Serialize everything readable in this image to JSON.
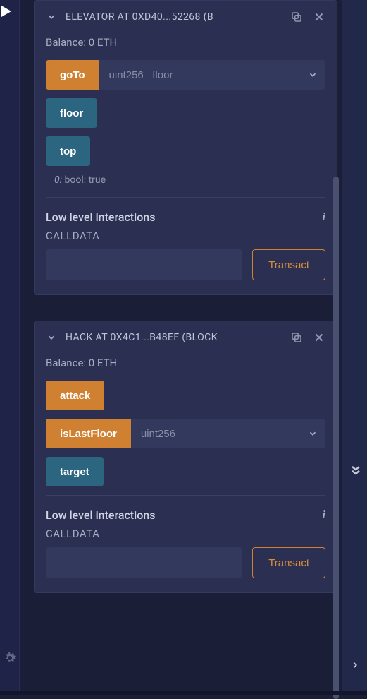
{
  "contracts": [
    {
      "title": "ELEVATOR AT 0XD40...52268 (B",
      "balance": "Balance: 0 ETH",
      "functions": {
        "goTo": {
          "label": "goTo",
          "placeholder": "uint256 _floor",
          "color": "orange",
          "hasInput": true
        },
        "floor": {
          "label": "floor",
          "color": "blue",
          "hasInput": false
        },
        "top": {
          "label": "top",
          "color": "blue",
          "hasInput": false,
          "returnIndex": "0:",
          "returnType": "bool:",
          "returnValue": "true"
        }
      },
      "lowLevel": {
        "title": "Low level interactions",
        "calldataLabel": "CALLDATA",
        "transactLabel": "Transact"
      }
    },
    {
      "title": "HACK AT 0X4C1...B48EF (BLOCK",
      "balance": "Balance: 0 ETH",
      "functions": {
        "attack": {
          "label": "attack",
          "color": "orange",
          "hasInput": false
        },
        "isLastFloor": {
          "label": "isLastFloor",
          "placeholder": "uint256",
          "color": "orange",
          "hasInput": true
        },
        "target": {
          "label": "target",
          "color": "blue",
          "hasInput": false
        }
      },
      "lowLevel": {
        "title": "Low level interactions",
        "calldataLabel": "CALLDATA",
        "transactLabel": "Transact"
      }
    }
  ]
}
